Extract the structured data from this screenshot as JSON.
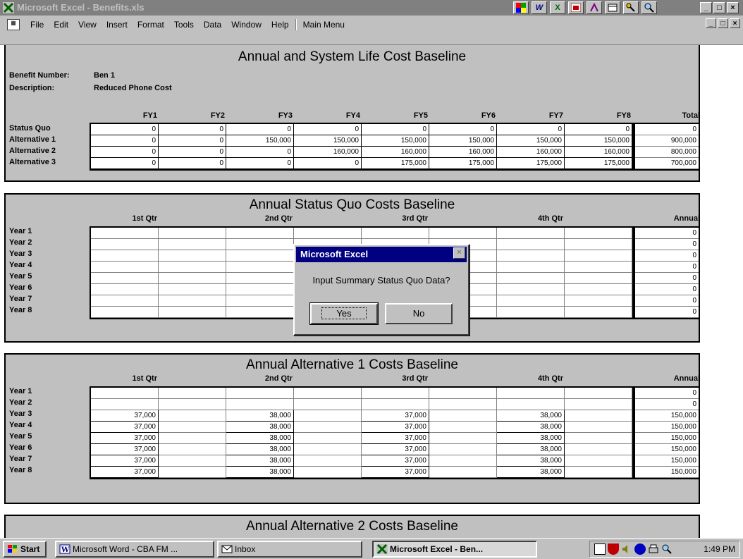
{
  "window": {
    "title": "Microsoft Excel - Benefits.xls",
    "tray_icons": [
      "",
      "W",
      "X",
      "",
      "",
      "",
      "",
      ""
    ],
    "buttons": [
      "_",
      "□",
      "×"
    ]
  },
  "menubar": {
    "items": [
      "File",
      "Edit",
      "View",
      "Insert",
      "Format",
      "Tools",
      "Data",
      "Window",
      "Help",
      "Main Menu"
    ],
    "doc_buttons": [
      "_",
      "□",
      "×"
    ]
  },
  "summary": {
    "title": "Annual and System Life Cost Baseline",
    "benefit_number_label": "Benefit Number:",
    "benefit_number_value": "Ben 1",
    "description_label": "Description:",
    "description_value": "Reduced Phone Cost",
    "columns": [
      "FY1",
      "FY2",
      "FY3",
      "FY4",
      "FY5",
      "FY6",
      "FY7",
      "FY8"
    ],
    "total_label": "Total",
    "rows": [
      {
        "label": "Status Quo",
        "values": [
          "0",
          "0",
          "0",
          "0",
          "0",
          "0",
          "0",
          "0"
        ],
        "total": "0"
      },
      {
        "label": "Alternative 1",
        "values": [
          "0",
          "0",
          "150,000",
          "150,000",
          "150,000",
          "150,000",
          "150,000",
          "150,000"
        ],
        "total": "900,000"
      },
      {
        "label": "Alternative 2",
        "values": [
          "0",
          "0",
          "0",
          "160,000",
          "160,000",
          "160,000",
          "160,000",
          "160,000"
        ],
        "total": "800,000"
      },
      {
        "label": "Alternative 3",
        "values": [
          "0",
          "0",
          "0",
          "0",
          "175,000",
          "175,000",
          "175,000",
          "175,000"
        ],
        "total": "700,000"
      }
    ]
  },
  "status_quo": {
    "title": "Annual Status Quo Costs Baseline",
    "quarters": [
      "1st Qtr",
      "2nd Qtr",
      "3rd Qtr",
      "4th Qtr"
    ],
    "annual_label": "Annual",
    "years": [
      "Year 1",
      "Year 2",
      "Year 3",
      "Year 4",
      "Year 5",
      "Year 6",
      "Year 7",
      "Year 8"
    ],
    "cells": [
      [
        "",
        "",
        "",
        "",
        "",
        "",
        "",
        ""
      ],
      [
        "",
        "",
        "",
        "",
        "",
        "",
        "",
        ""
      ],
      [
        "",
        "",
        "",
        "",
        "",
        "",
        "",
        ""
      ],
      [
        "",
        "",
        "",
        "",
        "",
        "",
        "",
        ""
      ],
      [
        "",
        "",
        "",
        "",
        "",
        "",
        "",
        ""
      ],
      [
        "",
        "",
        "",
        "",
        "",
        "",
        "",
        ""
      ],
      [
        "",
        "",
        "",
        "",
        "",
        "",
        "",
        ""
      ],
      [
        "",
        "",
        "",
        "",
        "",
        "",
        "",
        ""
      ]
    ],
    "annual": [
      "0",
      "0",
      "0",
      "0",
      "0",
      "0",
      "0",
      "0"
    ]
  },
  "alt1": {
    "title": "Annual Alternative 1 Costs Baseline",
    "quarters": [
      "1st Qtr",
      "2nd Qtr",
      "3rd Qtr",
      "4th Qtr"
    ],
    "annual_label": "Annual",
    "years": [
      "Year 1",
      "Year 2",
      "Year 3",
      "Year 4",
      "Year 5",
      "Year 6",
      "Year 7",
      "Year 8"
    ],
    "cells": [
      [
        "",
        "",
        "",
        "",
        "",
        "",
        "",
        ""
      ],
      [
        "",
        "",
        "",
        "",
        "",
        "",
        "",
        ""
      ],
      [
        "37,000",
        "",
        "38,000",
        "",
        "37,000",
        "",
        "38,000",
        ""
      ],
      [
        "37,000",
        "",
        "38,000",
        "",
        "37,000",
        "",
        "38,000",
        ""
      ],
      [
        "37,000",
        "",
        "38,000",
        "",
        "37,000",
        "",
        "38,000",
        ""
      ],
      [
        "37,000",
        "",
        "38,000",
        "",
        "37,000",
        "",
        "38,000",
        ""
      ],
      [
        "37,000",
        "",
        "38,000",
        "",
        "37,000",
        "",
        "38,000",
        ""
      ],
      [
        "37,000",
        "",
        "38,000",
        "",
        "37,000",
        "",
        "38,000",
        ""
      ]
    ],
    "annual": [
      "0",
      "0",
      "150,000",
      "150,000",
      "150,000",
      "150,000",
      "150,000",
      "150,000"
    ]
  },
  "alt2": {
    "title": "Annual Alternative 2 Costs Baseline"
  },
  "dialog": {
    "title": "Microsoft Excel",
    "close": "×",
    "message": "Input Summary Status Quo Data?",
    "yes_label": "Yes",
    "no_label": "No"
  },
  "taskbar": {
    "start_label": "Start",
    "tasks": [
      "Microsoft Word - CBA FM ...",
      "Inbox",
      "Microsoft Excel - Ben..."
    ],
    "clock": "1:49 PM"
  },
  "colors": {
    "sheet_bg": "#c0c0c0",
    "dialog_title": "#000080",
    "title_inactive": "#808080"
  }
}
